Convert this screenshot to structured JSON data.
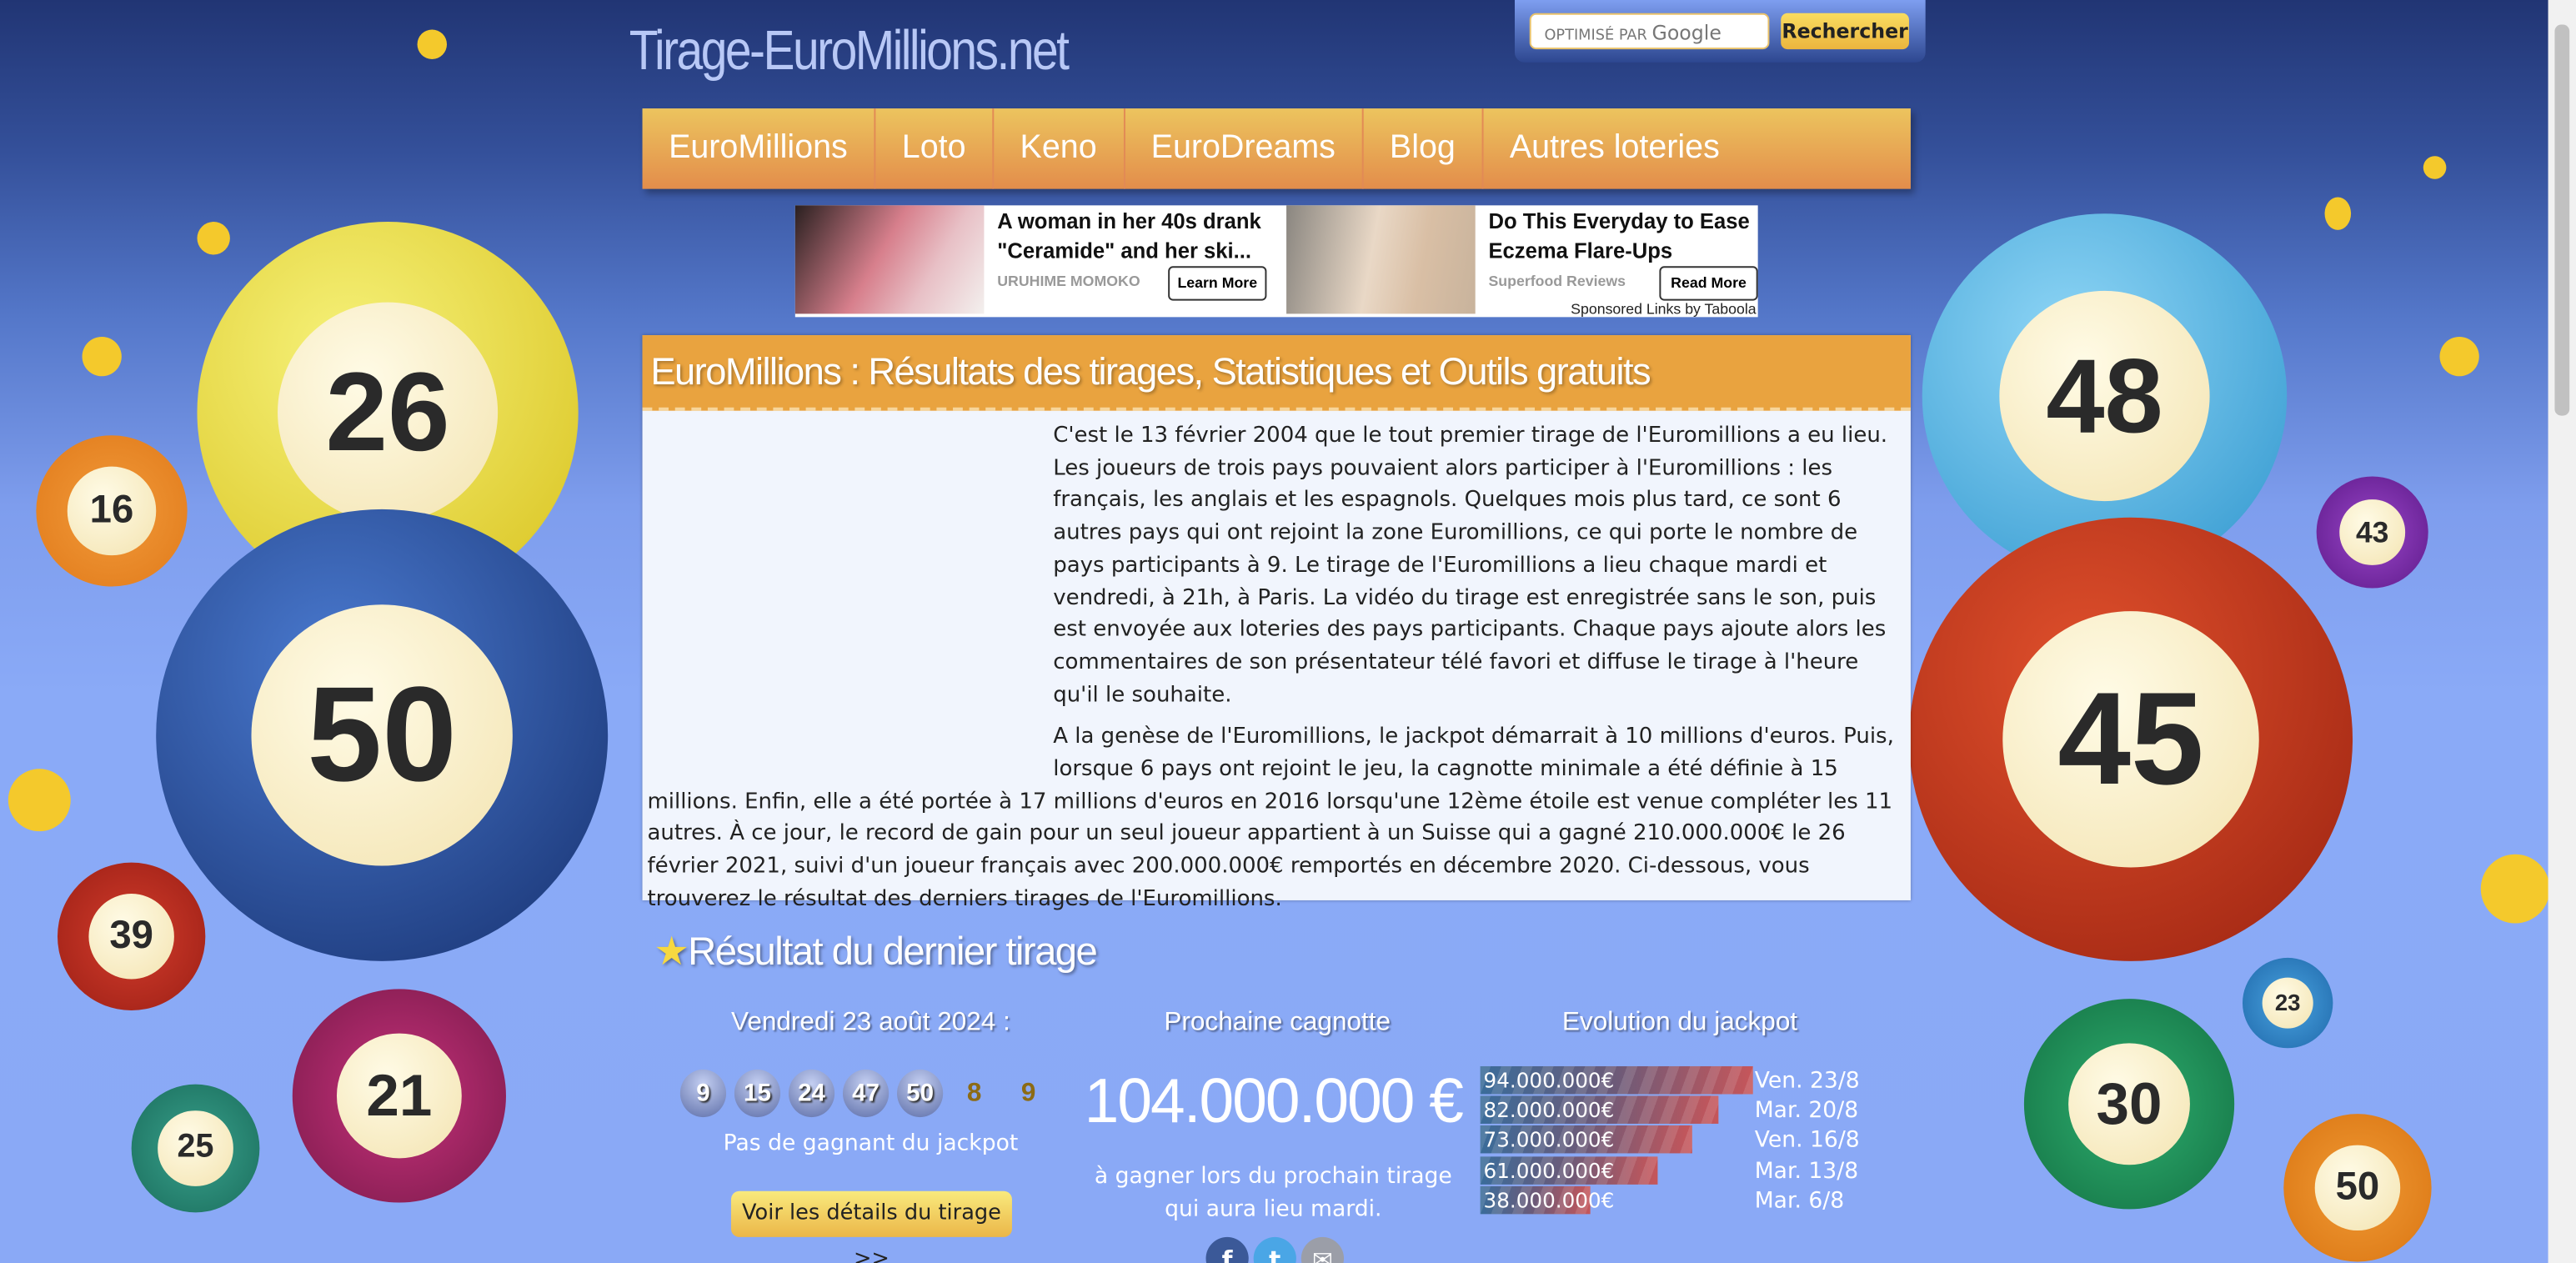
{
  "site": {
    "logo": "Tirage-EuroMillions.net"
  },
  "search": {
    "powered_by": "OPTIMISÉ PAR",
    "brand": "Google",
    "button": "Rechercher"
  },
  "nav": [
    "EuroMillions",
    "Loto",
    "Keno",
    "EuroDreams",
    "Blog",
    "Autres loteries"
  ],
  "ads": {
    "items": [
      {
        "title": "A woman in her 40s drank \"Ceramide\" and her ski...",
        "source": "URUHIME MOMOKO",
        "button": "Learn More"
      },
      {
        "title": "Do This Everyday to Ease Eczema Flare-Ups",
        "source": "Superfood Reviews",
        "button": "Read More"
      }
    ],
    "sponsored": "Sponsored Links by Taboola"
  },
  "intro": {
    "title": "EuroMillions : Résultats des tirages, Statistiques et Outils gratuits",
    "p1": "C'est le 13 février 2004 que le tout premier tirage de l'Euromillions a eu lieu. Les joueurs de trois pays pouvaient alors participer à l'Euromillions : les français, les anglais et les espagnols. Quelques mois plus tard, ce sont 6 autres pays qui ont rejoint la zone Euromillions, ce qui porte le nombre de pays participants à 9. Le tirage de l'Euromillions a lieu chaque mardi et vendredi, à 21h, à Paris. La vidéo du tirage est enregistrée sans le son, puis est envoyée aux loteries des pays participants. Chaque pays ajoute alors les commentaires de son présentateur télé favori et diffuse le tirage à l'heure qu'il le souhaite.",
    "p2": "A la genèse de l'Euromillions, le jackpot démarrait à 10 millions d'euros. Puis, lorsque 6 pays ont rejoint le jeu, la cagnotte minimale a été définie à 15 millions. Enfin, elle a été portée à 17 millions d'euros en 2016 lorsqu'une 12ème étoile est venue compléter les 11 autres. À ce jour, le record de gain pour un seul joueur appartient à un Suisse qui a gagné 210.000.000€ le 26 février 2021, suivi d'un joueur français avec 200.000.000€ remportés en décembre 2020. Ci-dessous, vous trouverez le résultat des derniers tirages de l'Euromillions."
  },
  "result": {
    "title": "Résultat du dernier tirage",
    "date": "Vendredi 23 août 2024 :",
    "numbers": [
      "9",
      "15",
      "24",
      "47",
      "50"
    ],
    "stars": [
      "8",
      "9"
    ],
    "no_winner": "Pas de gagnant du jackpot",
    "details_button": "Voir les détails du tirage >>",
    "next_title": "Prochaine cagnotte",
    "next_amount": "104.000.000 €",
    "next_sub": "à gagner lors du prochain tirage qui aura lieu mardi.",
    "evo_title": "Evolution du jackpot",
    "evolution": [
      {
        "amount": "94.000.000€",
        "date": "Ven. 23/8",
        "value": 94
      },
      {
        "amount": "82.000.000€",
        "date": "Mar. 20/8",
        "value": 82
      },
      {
        "amount": "73.000.000€",
        "date": "Ven. 16/8",
        "value": 73
      },
      {
        "amount": "61.000.000€",
        "date": "Mar. 13/8",
        "value": 61
      },
      {
        "amount": "38.000.000€",
        "date": "Mar. 6/8",
        "value": 38
      }
    ]
  },
  "social": {
    "facebook": "f",
    "twitter": "t",
    "email": "✉"
  },
  "deco_balls": [
    "26",
    "50",
    "16",
    "39",
    "21",
    "25",
    "48",
    "45",
    "43",
    "23",
    "30",
    "50"
  ]
}
